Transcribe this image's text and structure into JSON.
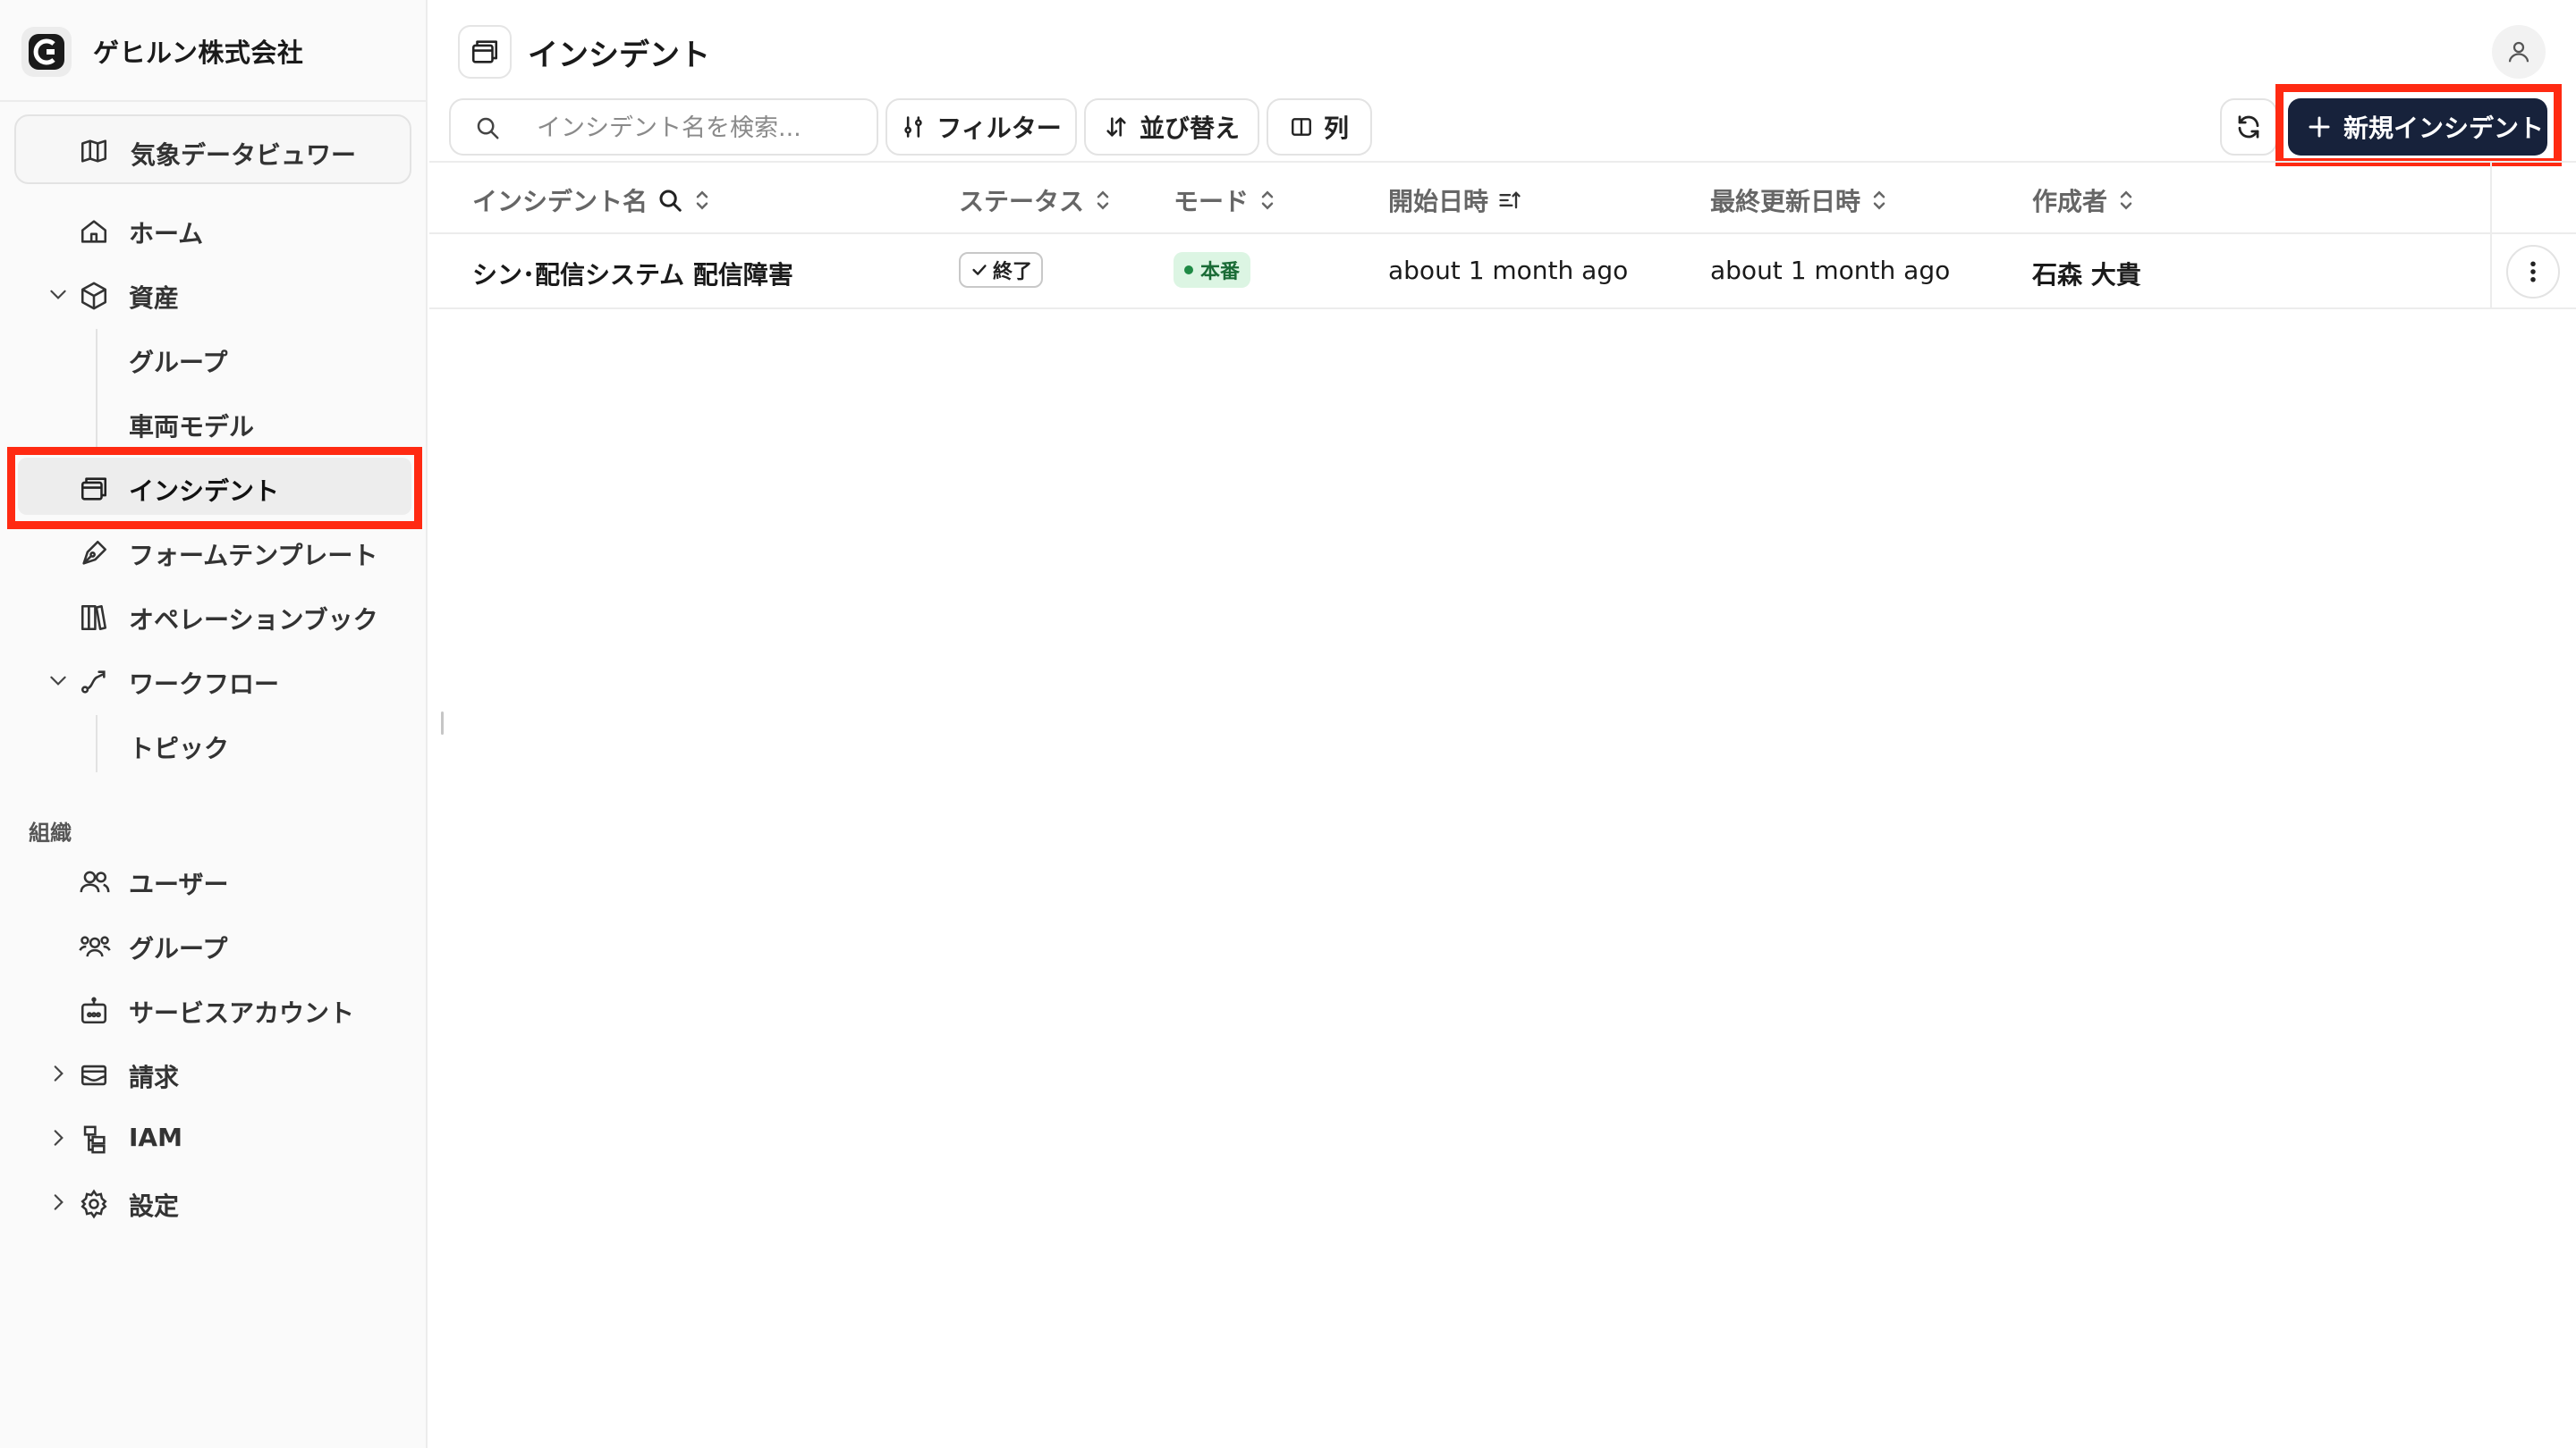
{
  "org": {
    "name": "ゲヒルン株式会社"
  },
  "sidebar": {
    "weather_viewer": "気象データビュワー",
    "items": {
      "home": "ホーム",
      "assets": "資産",
      "groups": "グループ",
      "vehicle_models": "車両モデル",
      "incidents": "インシデント",
      "form_templates": "フォームテンプレート",
      "operation_books": "オペレーションブック",
      "workflow": "ワークフロー",
      "topics": "トピック"
    },
    "org_section": {
      "label": "組織",
      "users": "ユーザー",
      "groups": "グループ",
      "service_accounts": "サービスアカウント",
      "billing": "請求",
      "iam": "IAM",
      "settings": "設定"
    }
  },
  "header": {
    "title": "インシデント"
  },
  "toolbar": {
    "search_placeholder": "インシデント名を検索...",
    "filter_label": "フィルター",
    "sort_label": "並び替え",
    "columns_label": "列",
    "new_incident_label": "新規インシデント"
  },
  "table": {
    "columns": {
      "name": "インシデント名",
      "status": "ステータス",
      "mode": "モード",
      "started_at": "開始日時",
      "updated_at": "最終更新日時",
      "author": "作成者"
    },
    "rows": [
      {
        "name": "シン･配信システム 配信障害",
        "status": "終了",
        "mode": "本番",
        "started_at": "about 1 month ago",
        "updated_at": "about 1 month ago",
        "author": "石森 大貴"
      }
    ]
  },
  "colors": {
    "primary_button": "#17223b",
    "highlight": "#ff2a12",
    "mode_badge_bg": "#dcf5e3",
    "mode_badge_text": "#1a6b36"
  }
}
